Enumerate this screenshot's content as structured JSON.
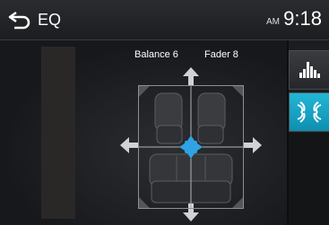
{
  "header": {
    "title": "EQ",
    "clock_ampm": "AM",
    "clock_time": "9:18"
  },
  "sound_field": {
    "balance_label": "Balance  6",
    "fader_label": "Fader  8",
    "balance": 6,
    "fader": 8
  },
  "sidebar": {
    "items": [
      {
        "icon": "equalizer-icon",
        "selected": false
      },
      {
        "icon": "balance-fader-icon",
        "selected": true
      }
    ]
  },
  "colors": {
    "accent": "#1aa9cf",
    "cursor": "#2fa3e6"
  }
}
